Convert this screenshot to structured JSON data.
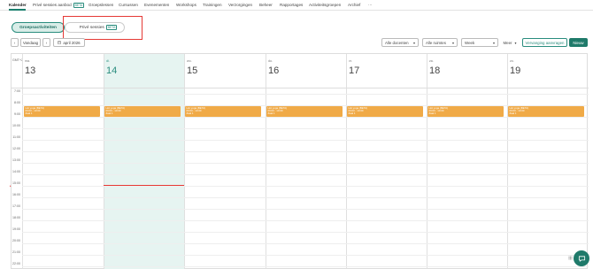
{
  "nav": {
    "items": [
      {
        "label": "Kalender",
        "active": true
      },
      {
        "label": "Privé sessies aanbod",
        "badge": "BETA"
      },
      {
        "label": "Groepslessen"
      },
      {
        "label": "Cursussen"
      },
      {
        "label": "Evenementen"
      },
      {
        "label": "Workshops"
      },
      {
        "label": "Trainingen"
      },
      {
        "label": "Verzorgingen"
      },
      {
        "label": "Beheer"
      },
      {
        "label": "Rapportages"
      },
      {
        "label": "Activiteitsgroepen"
      },
      {
        "label": "Archief"
      },
      {
        "label": "···"
      }
    ]
  },
  "pills": {
    "group_label": "Groepsactiviteiten",
    "private_label": "Privé sessies",
    "private_badge": "BETA"
  },
  "toolbar": {
    "prev": "‹",
    "today": "Vandaag",
    "next": "›",
    "date": "april 2026",
    "teachers": "Alle docenten",
    "rooms": "Alle ruimtes",
    "view": "Week",
    "more": "Meer",
    "request": "Vervanging aanvragen",
    "new": "Nieuw"
  },
  "calendar": {
    "timezone": "GMT+2",
    "days": [
      {
        "abbr": "ma.",
        "num": "13"
      },
      {
        "abbr": "di.",
        "num": "14",
        "today": true
      },
      {
        "abbr": "wo.",
        "num": "15"
      },
      {
        "abbr": "do.",
        "num": "16"
      },
      {
        "abbr": "vr.",
        "num": "17"
      },
      {
        "abbr": "za.",
        "num": "18"
      },
      {
        "abbr": "zo.",
        "num": "19"
      }
    ],
    "hours": [
      "7:00",
      "8:00",
      "9:00",
      "10:00",
      "11:00",
      "12:00",
      "13:00",
      "14:00",
      "15:00",
      "16:00",
      "17:00",
      "18:00",
      "19:00",
      "20:00",
      "21:00",
      "22:00"
    ],
    "event": {
      "line1": "Hot yoga (BETA)",
      "line2": "09:00 - 10:00",
      "line3": "Zaal 1"
    }
  },
  "colors": {
    "accent": "#1f7a6a",
    "event": "#f0aa47",
    "today_bg": "#e6f4f1",
    "highlight": "#e53935"
  }
}
